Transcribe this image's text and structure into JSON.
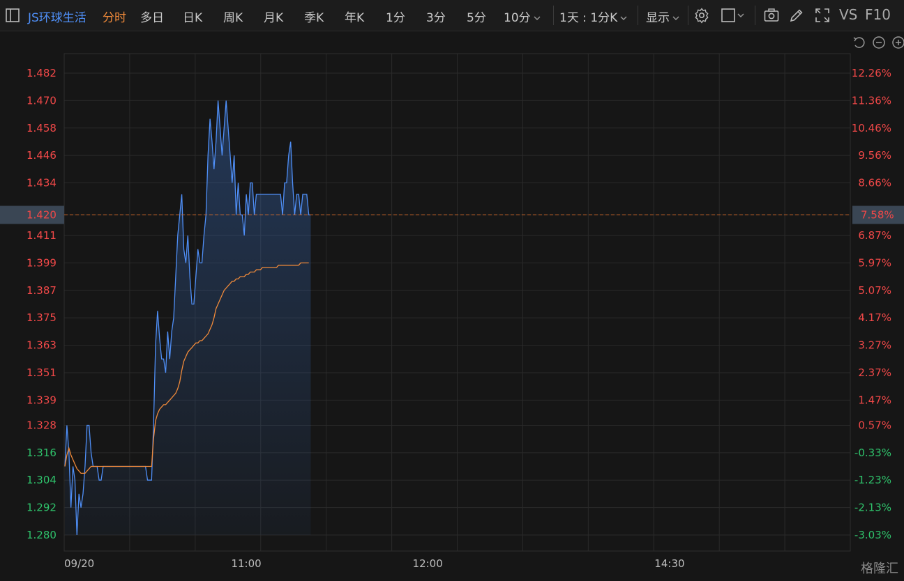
{
  "toolbar": {
    "stock_name": "JS环球生活",
    "periods": [
      "分时",
      "多日",
      "日K",
      "周K",
      "月K",
      "季K",
      "年K",
      "1分",
      "3分",
      "5分",
      "10分"
    ],
    "active_period": "分时",
    "range_select": "1天 : 1分K",
    "display_label": "显示",
    "vs_label": "VS",
    "f10_label": "F10"
  },
  "colors": {
    "background": "#161616",
    "price_line": "#4f8ff7",
    "avg_line": "#f08a3a",
    "up": "#f04848",
    "down": "#2fc26b",
    "grid": "#2a2a2a",
    "ref_line": "#d46a2a"
  },
  "chart_data": {
    "type": "line",
    "date_label": "09/20",
    "x_ticks": [
      "11:00",
      "12:00",
      "14:30"
    ],
    "y_ticks": [
      "1.482",
      "1.470",
      "1.458",
      "1.446",
      "1.434",
      "1.420",
      "1.411",
      "1.399",
      "1.387",
      "1.375",
      "1.363",
      "1.351",
      "1.339",
      "1.328",
      "1.316",
      "1.304",
      "1.292",
      "1.280"
    ],
    "pct_ticks": [
      "12.26%",
      "11.36%",
      "10.46%",
      "9.56%",
      "8.66%",
      "7.58%",
      "6.87%",
      "5.97%",
      "5.07%",
      "4.17%",
      "3.27%",
      "2.37%",
      "1.47%",
      "0.57%",
      "-0.33%",
      "-1.23%",
      "-2.13%",
      "-3.03%"
    ],
    "ylim": [
      1.28,
      1.482
    ],
    "prev_close": 1.32,
    "last_price": "1.420",
    "last_pct": "7.58%",
    "session_minutes": 390,
    "series": [
      {
        "role": "price",
        "values": [
          1.31,
          1.328,
          1.316,
          1.292,
          1.31,
          1.304,
          1.28,
          1.298,
          1.292,
          1.298,
          1.31,
          1.328,
          1.328,
          1.316,
          1.31,
          1.31,
          1.31,
          1.304,
          1.304,
          1.31,
          1.31,
          1.31,
          1.31,
          1.31,
          1.31,
          1.31,
          1.31,
          1.31,
          1.31,
          1.31,
          1.31,
          1.31,
          1.31,
          1.31,
          1.31,
          1.31,
          1.31,
          1.31,
          1.31,
          1.31,
          1.31,
          1.304,
          1.304,
          1.304,
          1.328,
          1.363,
          1.378,
          1.366,
          1.357,
          1.357,
          1.351,
          1.369,
          1.357,
          1.369,
          1.375,
          1.393,
          1.411,
          1.42,
          1.429,
          1.405,
          1.399,
          1.411,
          1.393,
          1.381,
          1.381,
          1.393,
          1.405,
          1.399,
          1.399,
          1.411,
          1.42,
          1.446,
          1.462,
          1.452,
          1.44,
          1.452,
          1.47,
          1.458,
          1.446,
          1.458,
          1.47,
          1.458,
          1.446,
          1.434,
          1.446,
          1.42,
          1.434,
          1.42,
          1.42,
          1.411,
          1.429,
          1.42,
          1.434,
          1.434,
          1.42,
          1.429,
          1.429,
          1.429,
          1.429,
          1.429,
          1.429,
          1.429,
          1.429,
          1.429,
          1.429,
          1.429,
          1.429,
          1.429,
          1.42,
          1.434,
          1.434,
          1.446,
          1.452,
          1.434,
          1.42,
          1.429,
          1.429,
          1.42,
          1.429,
          1.429,
          1.429,
          1.42,
          1.42
        ]
      },
      {
        "role": "average",
        "values": [
          1.31,
          1.315,
          1.318,
          1.315,
          1.313,
          1.311,
          1.309,
          1.308,
          1.307,
          1.307,
          1.307,
          1.308,
          1.309,
          1.31,
          1.31,
          1.31,
          1.31,
          1.31,
          1.31,
          1.31,
          1.31,
          1.31,
          1.31,
          1.31,
          1.31,
          1.31,
          1.31,
          1.31,
          1.31,
          1.31,
          1.31,
          1.31,
          1.31,
          1.31,
          1.31,
          1.31,
          1.31,
          1.31,
          1.31,
          1.31,
          1.31,
          1.31,
          1.31,
          1.31,
          1.322,
          1.33,
          1.333,
          1.335,
          1.336,
          1.337,
          1.337,
          1.338,
          1.339,
          1.34,
          1.341,
          1.342,
          1.344,
          1.347,
          1.352,
          1.356,
          1.358,
          1.36,
          1.361,
          1.362,
          1.363,
          1.364,
          1.364,
          1.365,
          1.365,
          1.366,
          1.367,
          1.368,
          1.37,
          1.372,
          1.375,
          1.379,
          1.381,
          1.383,
          1.385,
          1.387,
          1.388,
          1.389,
          1.39,
          1.391,
          1.391,
          1.392,
          1.392,
          1.393,
          1.393,
          1.393,
          1.394,
          1.394,
          1.395,
          1.395,
          1.395,
          1.396,
          1.396,
          1.396,
          1.397,
          1.397,
          1.397,
          1.397,
          1.397,
          1.397,
          1.397,
          1.397,
          1.398,
          1.398,
          1.398,
          1.398,
          1.398,
          1.398,
          1.398,
          1.398,
          1.398,
          1.398,
          1.398,
          1.399,
          1.399,
          1.399,
          1.399,
          1.399
        ]
      }
    ]
  },
  "watermark": "格隆汇"
}
